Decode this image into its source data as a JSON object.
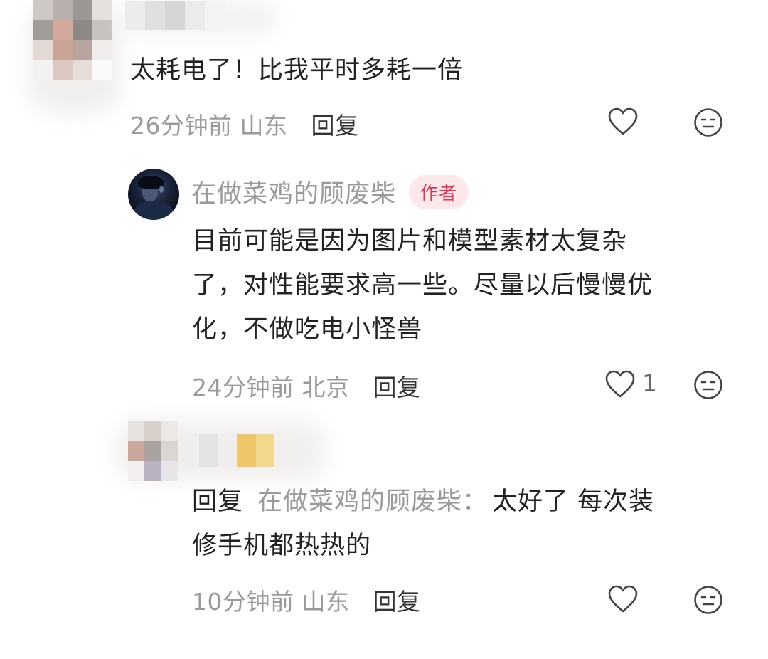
{
  "comments": [
    {
      "text": "太耗电了！比我平时多耗一倍",
      "time": "26分钟前",
      "location": "山东",
      "reply_label": "回复"
    },
    {
      "username": "在做菜鸡的顾废柴",
      "badge": "作者",
      "text_lines": [
        "目前可能是因为图片和模型素材太复杂",
        "了，对性能要求高一些。尽量以后慢慢优",
        "化，不做吃电小怪兽"
      ],
      "time": "24分钟前",
      "location": "北京",
      "reply_label": "回复",
      "like_count": "1"
    },
    {
      "reply_prefix": "回复",
      "reply_target": "在做菜鸡的顾废柴：",
      "text_first": "太好了 每次装",
      "text_second": "修手机都热热的",
      "time": "10分钟前",
      "location": "山东",
      "reply_label": "回复"
    }
  ],
  "icons": {
    "like": "heart-outline-icon",
    "dislike": "neutral-face-icon"
  }
}
